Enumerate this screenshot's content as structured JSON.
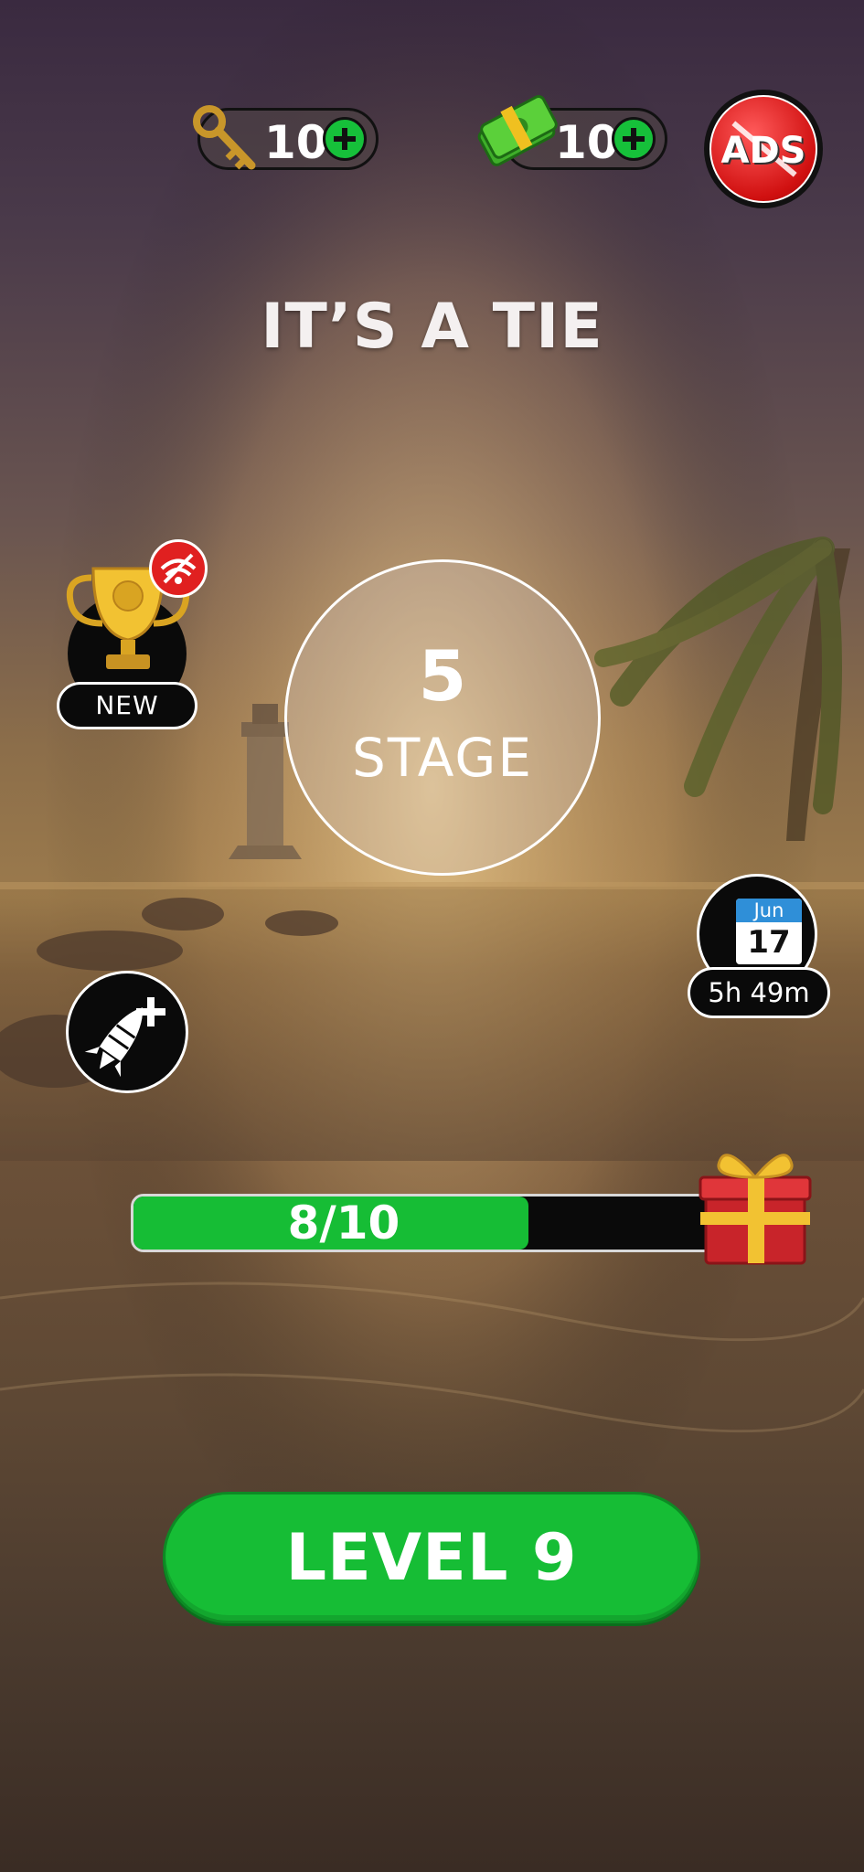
{
  "currency": {
    "keys": {
      "count": "10",
      "icon": "key-icon"
    },
    "cash": {
      "count": "10",
      "icon": "cash-icon"
    }
  },
  "ads_button": {
    "label": "ADS",
    "icon": "no-ads-icon"
  },
  "result_title": "IT’S A TIE",
  "stage": {
    "number": "5",
    "label": "STAGE"
  },
  "trophy": {
    "badge_label": "NEW",
    "icon": "trophy-icon"
  },
  "daily": {
    "month": "Jun",
    "day": "17",
    "timer": "5h 49m"
  },
  "booster": {
    "icon": "rocket-plus-icon"
  },
  "progress": {
    "text": "8/10",
    "current": 8,
    "total": 10,
    "reward_icon": "gift-icon"
  },
  "level_button": {
    "label": "LEVEL 9"
  },
  "colors": {
    "green": "#16bd35",
    "red": "#d01010",
    "dark": "#0a0a0a"
  }
}
